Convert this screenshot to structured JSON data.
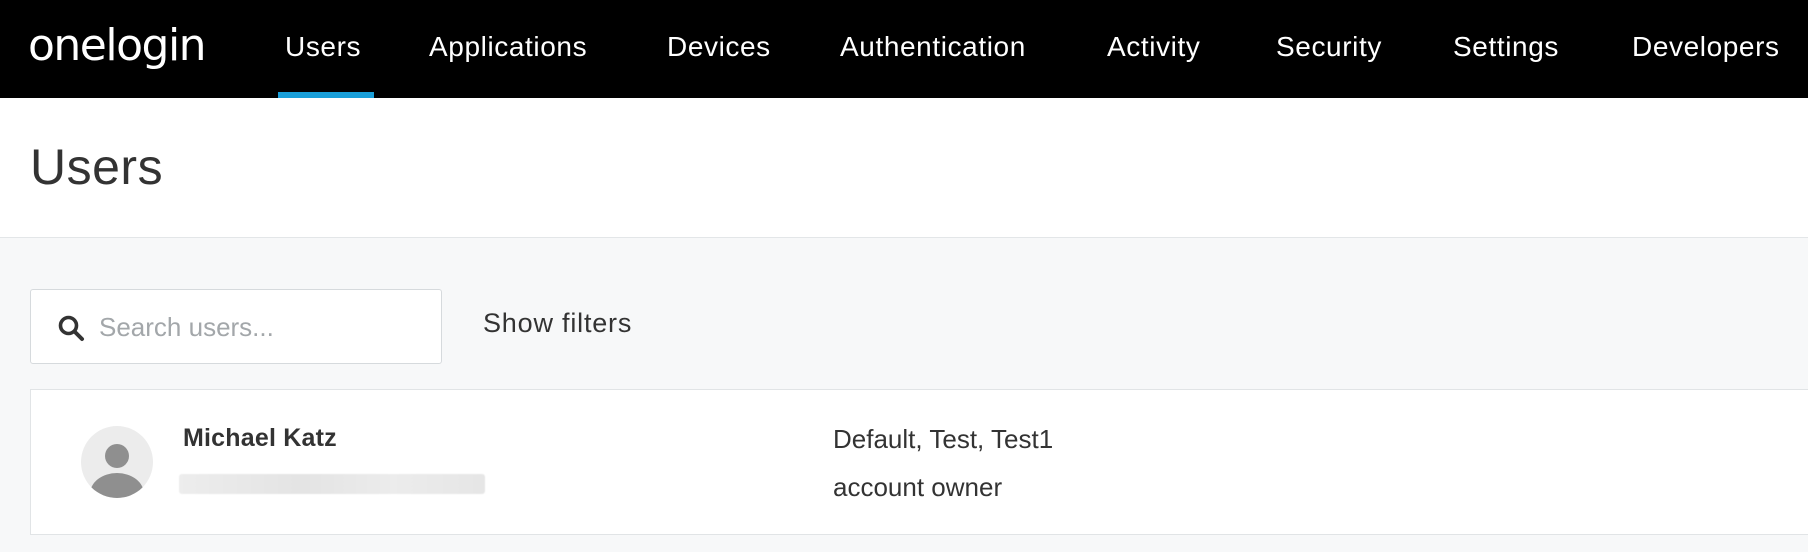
{
  "brand": {
    "logo_text": "onelogin",
    "accent_color": "#1a9fd9",
    "nav_background": "#000000"
  },
  "nav": {
    "items": [
      {
        "label": "Users",
        "active": true
      },
      {
        "label": "Applications",
        "active": false
      },
      {
        "label": "Devices",
        "active": false
      },
      {
        "label": "Authentication",
        "active": false
      },
      {
        "label": "Activity",
        "active": false
      },
      {
        "label": "Security",
        "active": false
      },
      {
        "label": "Settings",
        "active": false
      },
      {
        "label": "Developers",
        "active": false
      }
    ]
  },
  "page": {
    "title": "Users"
  },
  "toolbar": {
    "search_placeholder": "Search users...",
    "search_value": "",
    "search_icon": "search-icon",
    "show_filters_label": "Show filters"
  },
  "users": [
    {
      "name": "Michael Katz",
      "roles": "Default, Test, Test1",
      "user_type": "account owner",
      "avatar_icon": "user-avatar-icon"
    }
  ]
}
